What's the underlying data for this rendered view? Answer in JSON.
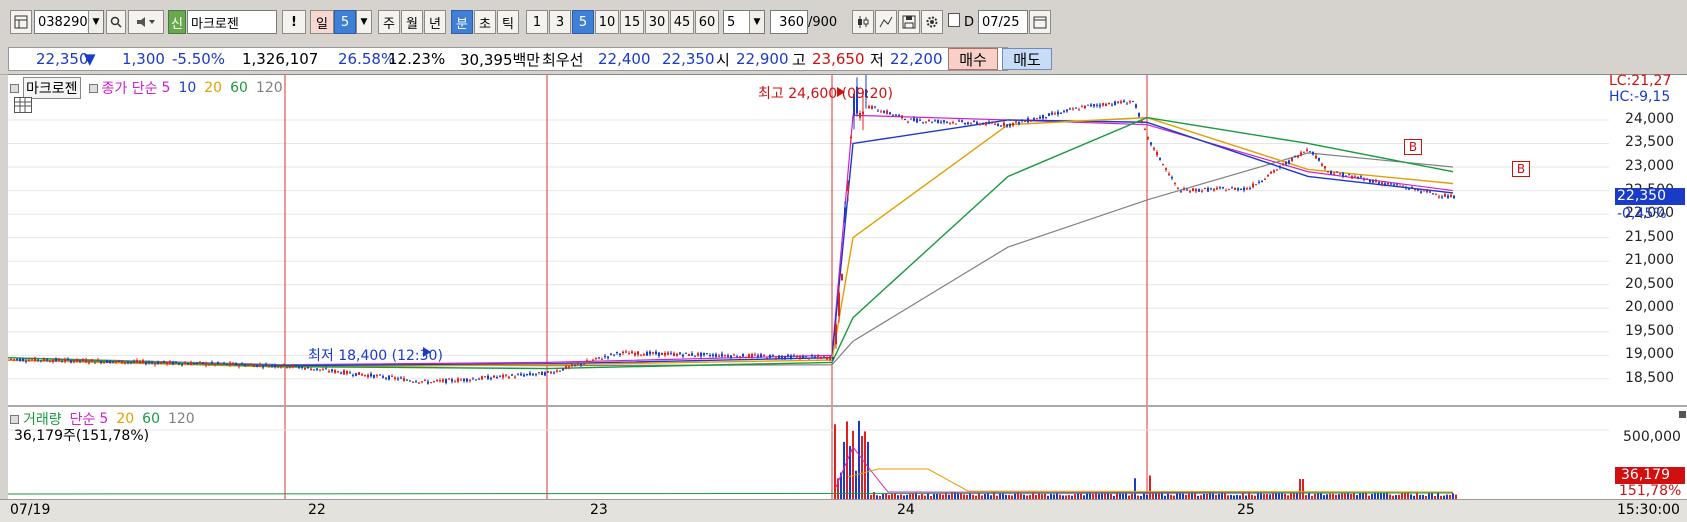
{
  "toolbar": {
    "stock_code": "038290",
    "credit_badge": "신",
    "stock_name": "마크로젠",
    "warn": "!",
    "period_day": "일",
    "period_day_num": "5",
    "period_week": "주",
    "period_month": "월",
    "period_year": "년",
    "period_minute": "분",
    "period_second": "초",
    "period_tick": "틱",
    "minute_options": [
      "1",
      "3",
      "5",
      "10",
      "15",
      "30",
      "45",
      "60"
    ],
    "selected_minute": "5",
    "custom_value": "5",
    "bar_count": "360",
    "bar_total": "/900",
    "date_label": "D",
    "date_value": "07/25",
    "colors": {
      "active": "#3f7fd6",
      "panel_bg": "#d6d3ce"
    }
  },
  "quote": {
    "price": "22,350",
    "arrow": "▼",
    "change": "1,300",
    "change_pct": "-5.50%",
    "volume": "1,326,107",
    "vol_ratio": "26.58%",
    "turnover": "12.23%",
    "amount": "30,395백만",
    "best_label": "최우선",
    "ask": "22,400",
    "bid": "22,350",
    "open_label": "시",
    "open": "22,900",
    "high_label": "고",
    "high": "23,650",
    "low_label": "저",
    "low": "22,200",
    "buy_label": "매수",
    "sell_label": "매도"
  },
  "price_panel": {
    "stock_label": "마크로젠",
    "indicator_label": "종가 단순",
    "ma_periods": [
      "5",
      "10",
      "20",
      "60",
      "120"
    ],
    "ma_colors": [
      "#d020d0",
      "#1a3ac8",
      "#e0a000",
      "#1a9a40",
      "#808080"
    ],
    "high_annotation": "최고 24,600 (09:20)",
    "low_annotation": "최저 18,400 (12:30)",
    "lc": "LC:21,27",
    "hc": "HC:-9,15",
    "current_price": "22,350",
    "current_change": "-0,45%",
    "y_ticks": [
      "24,000",
      "23,500",
      "23,000",
      "22,500",
      "22,000",
      "21,500",
      "21,000",
      "20,500",
      "20,000",
      "19,500",
      "19,000",
      "18,500"
    ],
    "buy_marker": "B",
    "sell_marker": "B"
  },
  "volume_panel": {
    "label": "거래량",
    "indicator_label": "단순",
    "ma_periods": [
      "5",
      "20",
      "60",
      "120"
    ],
    "info": "36,179주(151,78%)",
    "y_tick": "500,000",
    "current_volume": "36,179",
    "current_pct": "151,78%"
  },
  "x_axis": {
    "labels": [
      "07/19",
      "22",
      "23",
      "24",
      "25"
    ],
    "last_time": "15:30:00"
  },
  "chart_data": {
    "type": "line",
    "x": [
      "07/19",
      "22",
      "23",
      "24 09:00",
      "24 09:20",
      "24 12:00",
      "25 09:00",
      "25 12:00",
      "25 15:30"
    ],
    "series": [
      {
        "name": "5",
        "values": [
          18900,
          18800,
          18850,
          19000,
          24100,
          24000,
          23900,
          22900,
          22500
        ]
      },
      {
        "name": "120",
        "values": [
          18950,
          18800,
          18780,
          18800,
          19300,
          21300,
          22300,
          23300,
          23000
        ]
      }
    ],
    "y_ticks": [
      18500,
      19000,
      19500,
      20000,
      20500,
      21000,
      21500,
      22000,
      22500,
      23000,
      23500,
      24000
    ],
    "ylim": [
      18200,
      24700
    ],
    "grid": true
  }
}
